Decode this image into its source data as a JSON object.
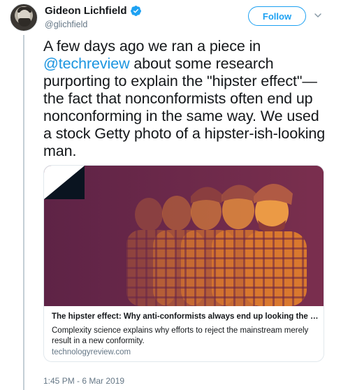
{
  "user": {
    "name": "Gideon Lichfield",
    "handle": "@glichfield",
    "verified": true
  },
  "actions": {
    "follow_label": "Follow"
  },
  "tweet": {
    "text_before_mention": "A few days ago we ran a piece in ",
    "mention": "@techreview",
    "text_after_mention": " about some research purporting to explain the \"hipster effect\"—the fact that nonconformists often end up nonconforming in the same way. We used a stock Getty photo of a hipster-ish-looking man."
  },
  "card": {
    "title": "The hipster effect: Why anti-conformists always end up looking the s...",
    "description": "Complexity science explains why efforts to reject the mainstream merely result in a new conformity.",
    "domain": "technologyreview.com"
  },
  "timestamp": "1:45 PM - 6 Mar 2019",
  "colors": {
    "accent": "#1da1f2",
    "link": "#1b95e0",
    "secondary_text": "#657786",
    "image_purple": "#6e2a4a",
    "image_orange": "#e08a2c"
  },
  "icons": {
    "verified": "verified-badge-icon",
    "menu": "chevron-down-icon"
  }
}
